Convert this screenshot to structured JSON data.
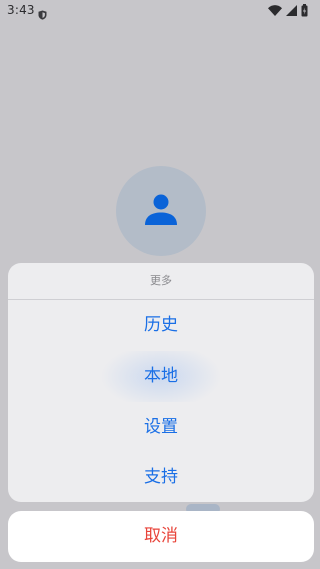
{
  "status_bar": {
    "time": "3:43",
    "left_icon": "shield-icon",
    "right_icons": [
      "wifi-icon",
      "cellular-signal-icon",
      "battery-charging-icon"
    ]
  },
  "avatar": {
    "icon": "user-icon"
  },
  "action_sheet": {
    "title": "更多",
    "options": [
      {
        "label": "历史"
      },
      {
        "label": "本地"
      },
      {
        "label": "设置"
      },
      {
        "label": "支持"
      }
    ],
    "cancel_label": "取消"
  },
  "colors": {
    "option_text": "#1a6fe6",
    "cancel_text": "#e8443a",
    "avatar_icon": "#0a63d8",
    "backdrop": "#c7c6ca"
  }
}
